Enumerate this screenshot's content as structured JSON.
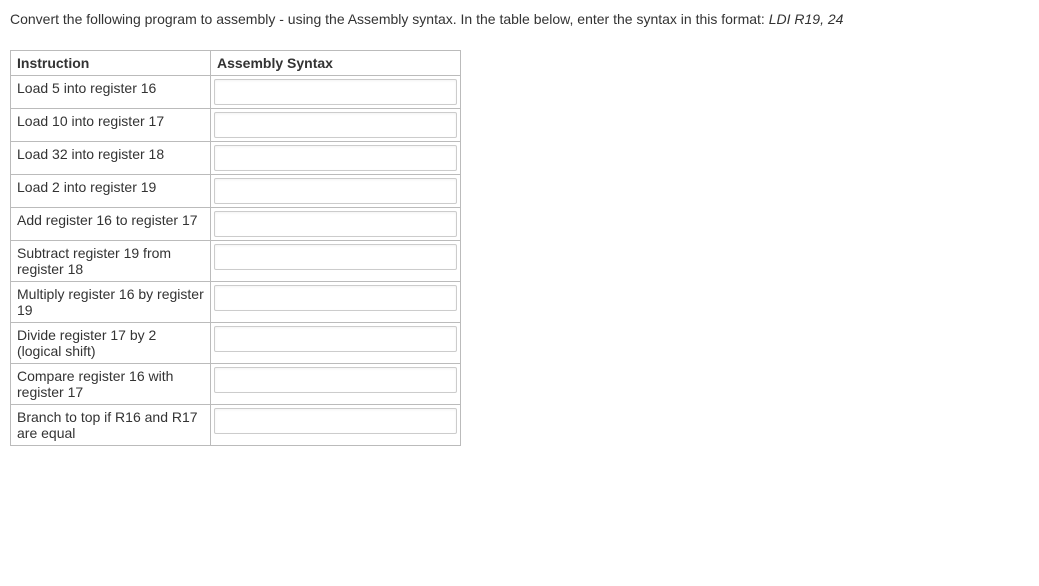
{
  "prompt": {
    "text_before_example": "Convert the following program to assembly - using the Assembly syntax. In the table below, enter the syntax in this format: ",
    "example": "LDI R19, 24"
  },
  "table": {
    "headers": {
      "instruction": "Instruction",
      "assembly_syntax": "Assembly Syntax"
    },
    "rows": [
      {
        "instruction": "Load 5 into register 16",
        "value": ""
      },
      {
        "instruction": "Load 10 into register 17",
        "value": ""
      },
      {
        "instruction": "Load 32 into register 18",
        "value": ""
      },
      {
        "instruction": "Load 2 into register 19",
        "value": ""
      },
      {
        "instruction": "Add register 16 to register 17",
        "value": ""
      },
      {
        "instruction": "Subtract register 19 from register 18",
        "value": ""
      },
      {
        "instruction": "Multiply register 16 by register 19",
        "value": ""
      },
      {
        "instruction": "Divide register 17 by 2 (logical shift)",
        "value": ""
      },
      {
        "instruction": "Compare register 16 with register 17",
        "value": ""
      },
      {
        "instruction": "Branch to top if R16 and R17 are equal",
        "value": ""
      }
    ]
  }
}
